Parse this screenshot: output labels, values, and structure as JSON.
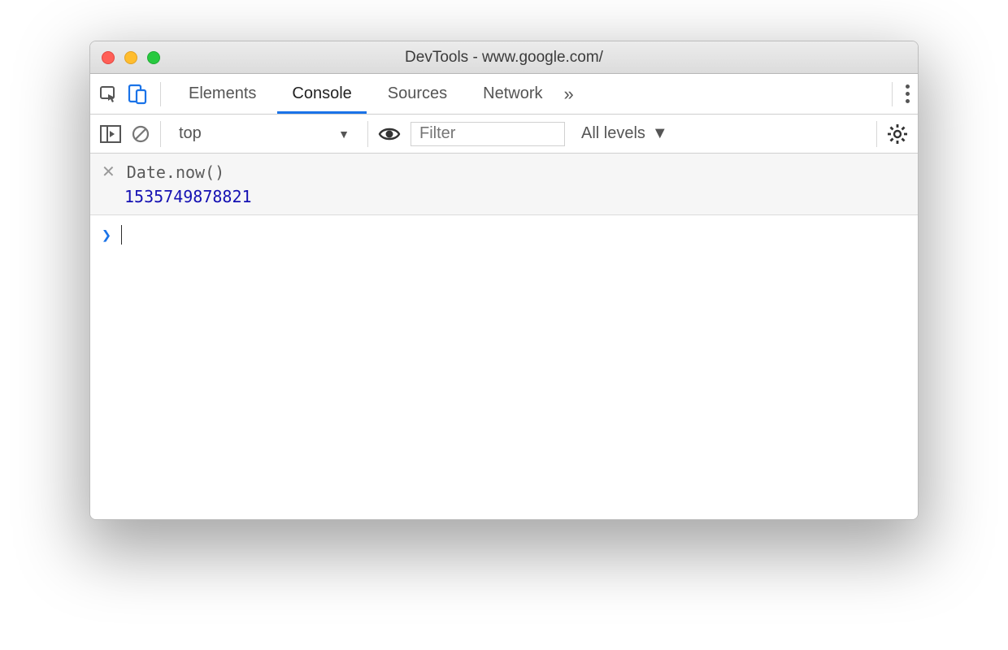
{
  "window": {
    "title": "DevTools - www.google.com/"
  },
  "tabs": {
    "items": [
      "Elements",
      "Console",
      "Sources",
      "Network"
    ],
    "active_index": 1
  },
  "toolbar": {
    "context": "top",
    "filter_placeholder": "Filter",
    "levels_label": "All levels"
  },
  "console": {
    "history": [
      {
        "expression": "Date.now()",
        "result": "1535749878821"
      }
    ]
  }
}
